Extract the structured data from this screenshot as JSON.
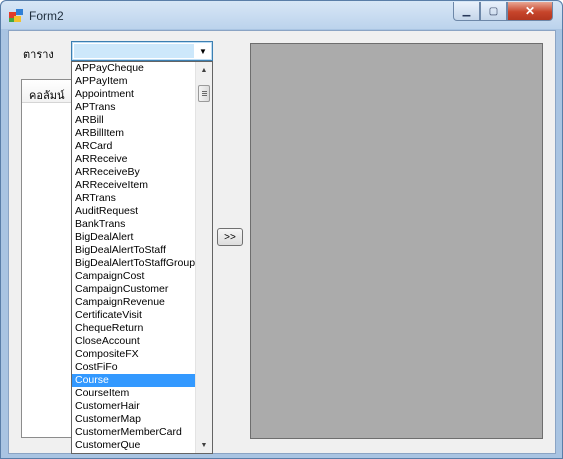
{
  "window": {
    "title": "Form2",
    "min_label": "▁",
    "max_label": "▢",
    "close_label": "✕"
  },
  "form": {
    "table_label": "ตาราง",
    "combo_value": "",
    "columns_header": "คอลัมน์",
    "move_button": ">>"
  },
  "dropdown": {
    "items": [
      "APPayCheque",
      "APPayItem",
      "Appointment",
      "APTrans",
      "ARBill",
      "ARBillItem",
      "ARCard",
      "ARReceive",
      "ARReceiveBy",
      "ARReceiveItem",
      "ARTrans",
      "AuditRequest",
      "BankTrans",
      "BigDealAlert",
      "BigDealAlertToStaff",
      "BigDealAlertToStaffGroup",
      "CampaignCost",
      "CampaignCustomer",
      "CampaignRevenue",
      "CertificateVisit",
      "ChequeReturn",
      "CloseAccount",
      "CompositeFX",
      "CostFiFo",
      "Course",
      "CourseItem",
      "CustomerHair",
      "CustomerMap",
      "CustomerMemberCard",
      "CustomerQue"
    ],
    "selected_index": 24,
    "scroll_up": "▲",
    "scroll_down": "▼"
  },
  "colors": {
    "selection": "#3399ff",
    "panel": "#ababab",
    "client_bg": "#f0f0f0"
  }
}
